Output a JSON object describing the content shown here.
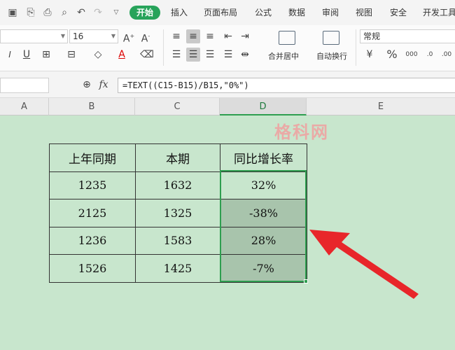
{
  "menubar": {
    "tabs": [
      "开始",
      "插入",
      "页面布局",
      "公式",
      "数据",
      "审阅",
      "视图",
      "安全",
      "开发工具"
    ],
    "active_tab": "开始",
    "accent_color": "#27a35a"
  },
  "ribbon": {
    "font_name": "",
    "font_size": "16",
    "number_format": "常规",
    "merge_center_label": "合并居中",
    "wrap_text_label": "自动换行"
  },
  "formula_bar": {
    "name_box": "",
    "fx_label": "fx",
    "formula": "=TEXT((C15-B15)/B15,\"0%\")"
  },
  "columns": [
    "A",
    "B",
    "C",
    "D",
    "E"
  ],
  "selected_column": "D",
  "table": {
    "headers": [
      "上年同期",
      "本期",
      "同比增长率"
    ],
    "rows": [
      [
        "1235",
        "1632",
        "32%"
      ],
      [
        "2125",
        "1325",
        "-38%"
      ],
      [
        "1236",
        "1583",
        "28%"
      ],
      [
        "1526",
        "1425",
        "-7%"
      ]
    ]
  },
  "watermark": "格科网",
  "colors": {
    "sheet_bg": "#c8e6cd",
    "selection_border": "#2e9e4f",
    "arrow": "#e8262a"
  }
}
